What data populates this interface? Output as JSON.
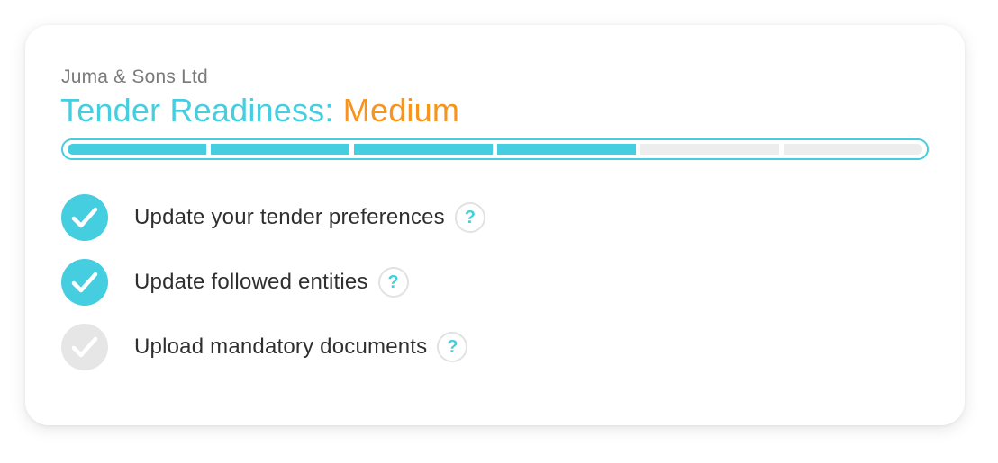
{
  "company_name": "Juma & Sons Ltd",
  "readiness": {
    "title_prefix": "Tender Readiness:",
    "level": "Medium",
    "segments_total": 6,
    "segments_filled": 4,
    "colors": {
      "accent": "#45cde0",
      "level": "#f7941d",
      "empty": "#ededed"
    }
  },
  "tasks": [
    {
      "label": "Update your tender preferences",
      "completed": true,
      "icon": "check-icon",
      "help_label": "?"
    },
    {
      "label": "Update followed entities",
      "completed": true,
      "icon": "check-icon",
      "help_label": "?"
    },
    {
      "label": "Upload mandatory documents",
      "completed": false,
      "icon": "check-icon",
      "help_label": "?"
    }
  ]
}
